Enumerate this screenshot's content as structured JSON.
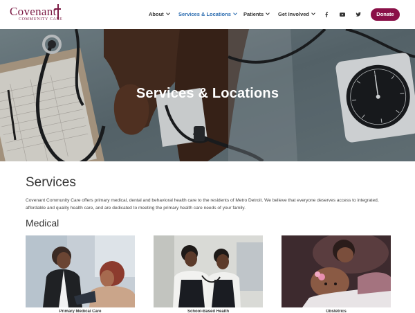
{
  "header": {
    "logo": {
      "name": "Covenant",
      "tagline": "COMMUNITY CARE"
    },
    "nav": [
      {
        "label": "About",
        "active": false
      },
      {
        "label": "Services & Locations",
        "active": true
      },
      {
        "label": "Patients",
        "active": false
      },
      {
        "label": "Get Involved",
        "active": false
      }
    ],
    "social": [
      "facebook-icon",
      "youtube-icon",
      "twitter-icon"
    ],
    "donate_label": "Donate"
  },
  "hero": {
    "title": "Services & Locations"
  },
  "main": {
    "services_heading": "Services",
    "intro_text": "Covenant Community Care offers primary medical, dental and behavioral health care to the residents of Metro Detroit. We believe that everyone deserves access to integrated, affordable and quality health care, and are dedicated to meeting the primary health care needs of your family.",
    "medical_heading": "Medical",
    "cards": [
      {
        "label": "Primary Medical Care"
      },
      {
        "label": "School-Based Health"
      },
      {
        "label": "Obstetrics"
      }
    ]
  },
  "colors": {
    "brand": "#7b1a44",
    "donate": "#8a1048",
    "nav_active": "#2b6cb0"
  }
}
